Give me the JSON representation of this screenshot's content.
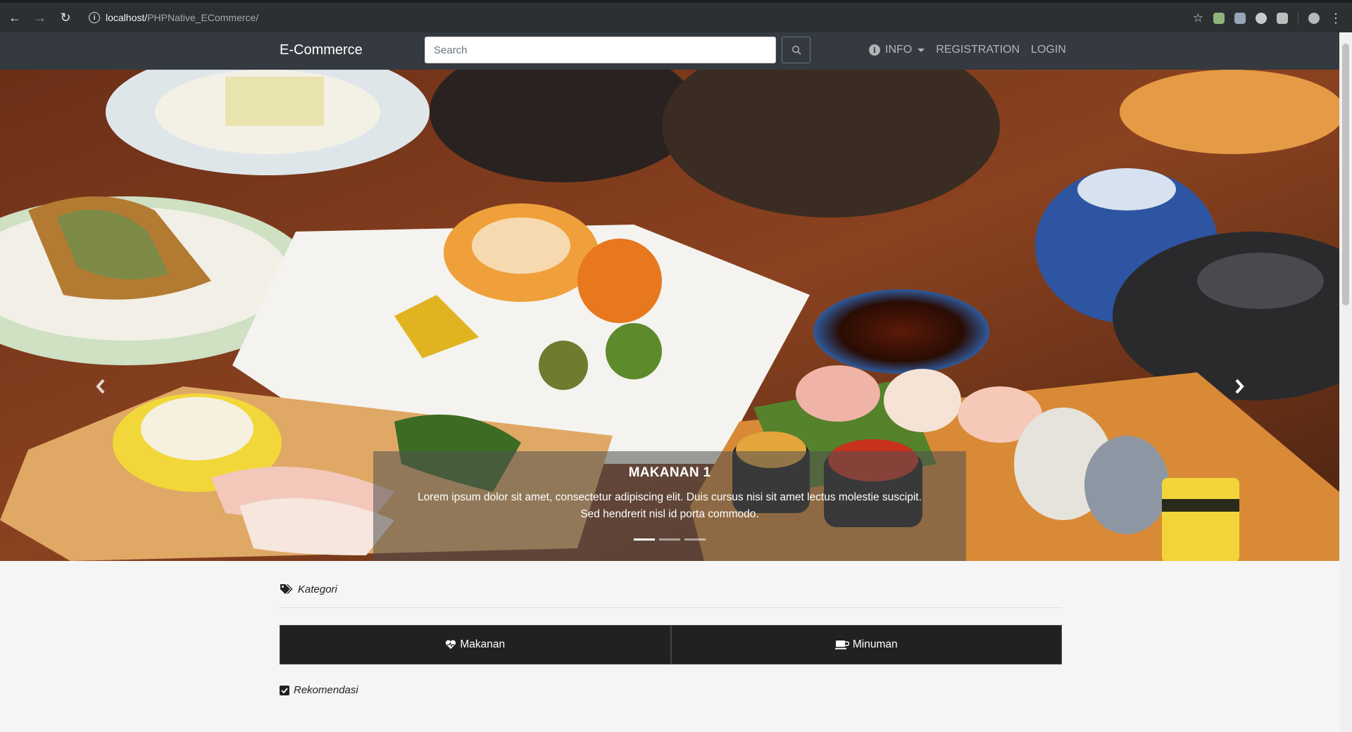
{
  "browser": {
    "url_host": "localhost/",
    "url_path": "PHPNative_ECommerce/"
  },
  "navbar": {
    "brand": "E-Commerce",
    "search_placeholder": "Search",
    "info_label": "INFO",
    "registration_label": "REGISTRATION",
    "login_label": "LOGIN"
  },
  "carousel": {
    "slides_count": 3,
    "active_index": 0,
    "caption_title": "MAKANAN 1",
    "caption_line1": "Lorem ipsum dolor sit amet, consectetur adipiscing elit. Duis cursus nisi sit amet lectus molestie suscipit.",
    "caption_line2": "Sed hendrerit nisl id porta commodo."
  },
  "categories": {
    "heading": "Kategori",
    "items": [
      {
        "label": "Makanan",
        "icon": "heart-icon"
      },
      {
        "label": "Minuman",
        "icon": "coffee-icon"
      }
    ]
  },
  "recommendations": {
    "heading": "Rekomendasi"
  }
}
